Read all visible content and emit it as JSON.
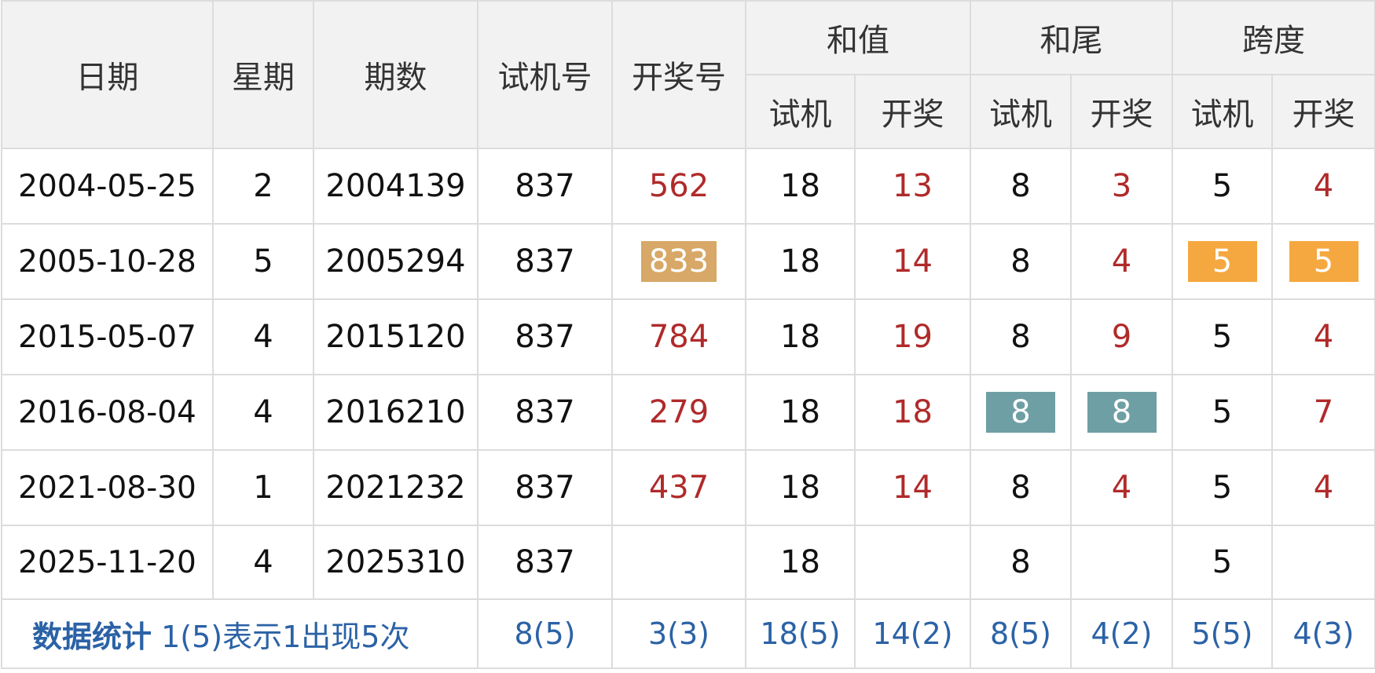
{
  "headers": {
    "date": "日期",
    "weekday": "星期",
    "issue": "期数",
    "trial_no": "试机号",
    "draw_no": "开奖号",
    "sum": "和值",
    "sum_tail": "和尾",
    "span": "跨度",
    "sub_trial": "试机",
    "sub_draw": "开奖"
  },
  "rows": [
    {
      "date": "2004-05-25",
      "weekday": "2",
      "issue": "2004139",
      "trial": "837",
      "draw": "562",
      "sum_trial": "18",
      "sum_draw": "13",
      "tail_trial": "8",
      "tail_draw": "3",
      "span_trial": "5",
      "span_draw": "4"
    },
    {
      "date": "2005-10-28",
      "weekday": "5",
      "issue": "2005294",
      "trial": "837",
      "draw": "833",
      "sum_trial": "18",
      "sum_draw": "14",
      "tail_trial": "8",
      "tail_draw": "4",
      "span_trial": "5",
      "span_draw": "5"
    },
    {
      "date": "2015-05-07",
      "weekday": "4",
      "issue": "2015120",
      "trial": "837",
      "draw": "784",
      "sum_trial": "18",
      "sum_draw": "19",
      "tail_trial": "8",
      "tail_draw": "9",
      "span_trial": "5",
      "span_draw": "4"
    },
    {
      "date": "2016-08-04",
      "weekday": "4",
      "issue": "2016210",
      "trial": "837",
      "draw": "279",
      "sum_trial": "18",
      "sum_draw": "18",
      "tail_trial": "8",
      "tail_draw": "8",
      "span_trial": "5",
      "span_draw": "7"
    },
    {
      "date": "2021-08-30",
      "weekday": "1",
      "issue": "2021232",
      "trial": "837",
      "draw": "437",
      "sum_trial": "18",
      "sum_draw": "14",
      "tail_trial": "8",
      "tail_draw": "4",
      "span_trial": "5",
      "span_draw": "4"
    },
    {
      "date": "2025-11-20",
      "weekday": "4",
      "issue": "2025310",
      "trial": "837",
      "draw": "",
      "sum_trial": "18",
      "sum_draw": "",
      "tail_trial": "8",
      "tail_draw": "",
      "span_trial": "5",
      "span_draw": ""
    }
  ],
  "stats": {
    "label": "数据统计",
    "note": "1(5)表示1出现5次",
    "trial": "8(5)",
    "draw": "3(3)",
    "sum_trial": "18(5)",
    "sum_draw": "14(2)",
    "tail_trial": "8(5)",
    "tail_draw": "4(2)",
    "span_trial": "5(5)",
    "span_draw": "4(3)"
  },
  "colors": {
    "draw_text": "#b02a2a",
    "highlight_tan": "#d7a867",
    "highlight_orange": "#f5a83f",
    "highlight_teal": "#6e9fa4",
    "stats_text": "#2b62a6"
  }
}
